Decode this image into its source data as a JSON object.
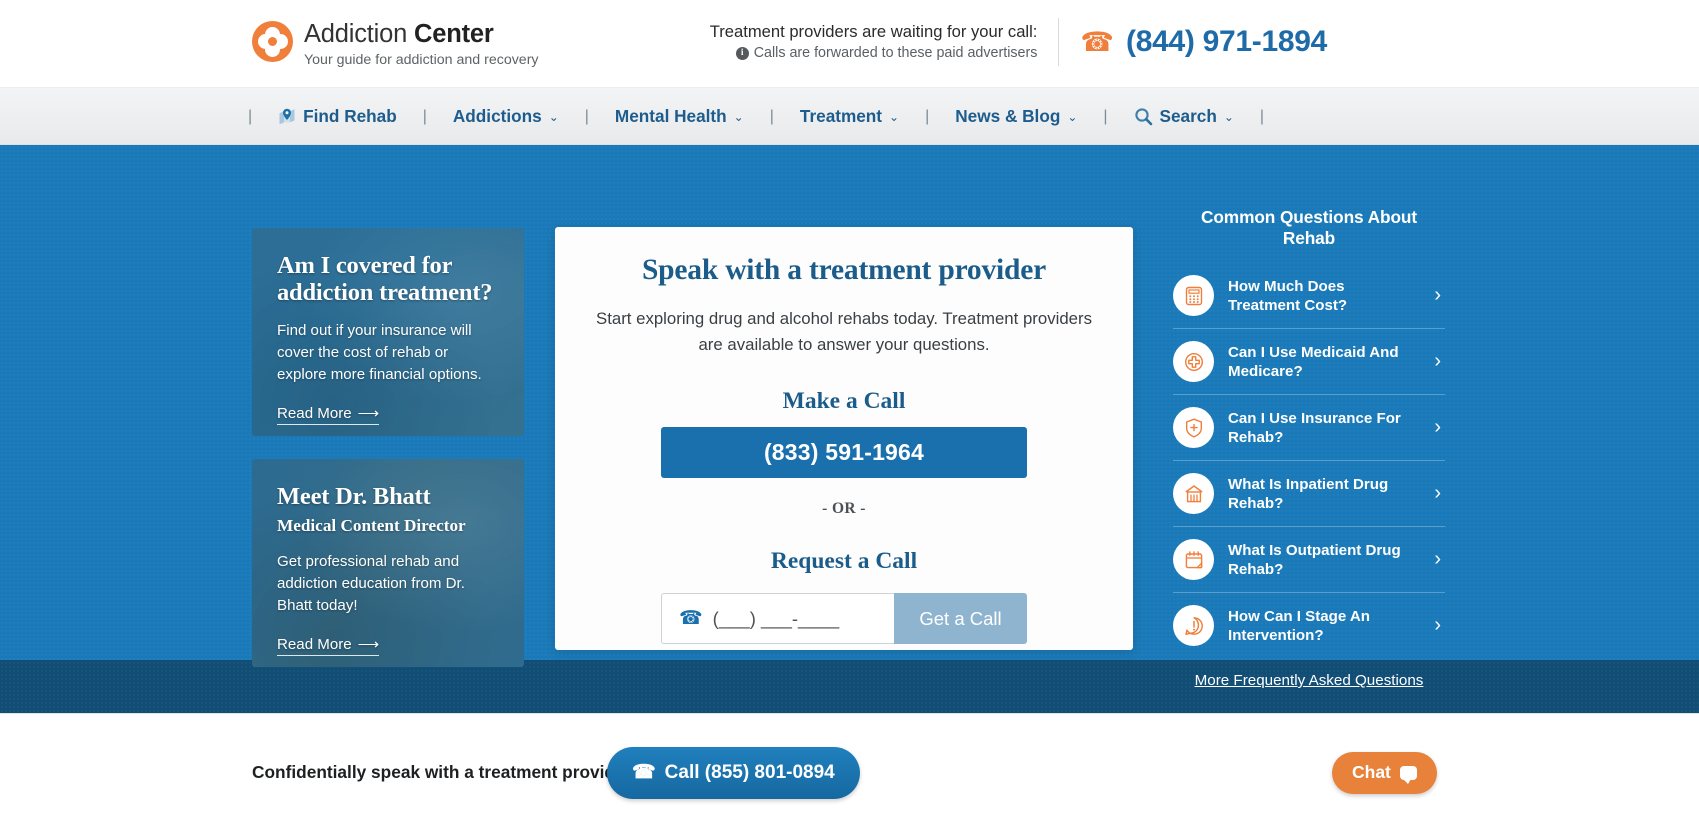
{
  "header": {
    "logo_primary_plain": "Addiction ",
    "logo_primary_bold": "Center",
    "logo_tagline": "Your guide for addiction and recovery",
    "cta_line1": "Treatment providers are waiting for your call:",
    "cta_line2": "Calls are forwarded to these paid advertisers",
    "info_glyph": "i",
    "phone": "(844) 971-1894",
    "phone_icon": "phone-icon"
  },
  "nav": {
    "divider": "|",
    "items": [
      {
        "label": "Find Rehab",
        "icon": "map-pin-icon",
        "caret": ""
      },
      {
        "label": "Addictions",
        "icon": "",
        "caret": "⌄"
      },
      {
        "label": "Mental Health",
        "icon": "",
        "caret": "⌄"
      },
      {
        "label": "Treatment",
        "icon": "",
        "caret": "⌄"
      },
      {
        "label": "News & Blog",
        "icon": "",
        "caret": "⌄"
      },
      {
        "label": "Search",
        "icon": "search-icon",
        "caret": "⌄"
      }
    ]
  },
  "promos": [
    {
      "title": "Am I covered for addiction treatment?",
      "subtitle": "",
      "body": "Find out if your insurance will cover the cost of rehab or explore more financial options.",
      "link": "Read More",
      "link_arrow": "⟶"
    },
    {
      "title": "Meet Dr. Bhatt",
      "subtitle": "Medical Content Director",
      "body": "Get professional rehab and addiction education from Dr. Bhatt today!",
      "link": "Read More",
      "link_arrow": "⟶"
    }
  ],
  "panel": {
    "title": "Speak with a treatment provider",
    "description": "Start exploring drug and alcohol rehabs today. Treatment providers are available to answer your questions.",
    "make_a_call_label": "Make a Call",
    "call_number": "(833) 591-1964",
    "or_label": "- OR -",
    "request_a_call_label": "Request a Call",
    "phone_placeholder": "(___) ___-____",
    "phone_value": "",
    "phone_icon": "phone-icon",
    "submit_label": "Get a Call"
  },
  "faq": {
    "heading": "Common Questions About Rehab",
    "chevron": "›",
    "items": [
      {
        "label": "How Much Does Treatment Cost?",
        "icon": "calculator-icon"
      },
      {
        "label": "Can I Use Medicaid And Medicare?",
        "icon": "medical-cross-icon"
      },
      {
        "label": "Can I Use Insurance For Rehab?",
        "icon": "shield-plus-icon"
      },
      {
        "label": "What Is Inpatient Drug Rehab?",
        "icon": "building-icon"
      },
      {
        "label": "What Is Outpatient Drug Rehab?",
        "icon": "calendar-icon"
      },
      {
        "label": "How Can I Stage An Intervention?",
        "icon": "alert-chat-icon"
      }
    ],
    "more_link": "More Frequently Asked Questions"
  },
  "bottom_bar": {
    "message": "Confidentially speak with a treatment provider",
    "call_label": "Call (855) 801-0894",
    "call_icon": "phone-icon",
    "chat_label": "Chat",
    "chat_icon": "chat-bubble-icon"
  },
  "colors": {
    "brand_orange": "#ef7f3b",
    "brand_blue": "#1a6fad",
    "hero_blue": "#1a79b8",
    "hero_dark_blue": "#114d75",
    "link_blue": "#1d5c8c"
  }
}
